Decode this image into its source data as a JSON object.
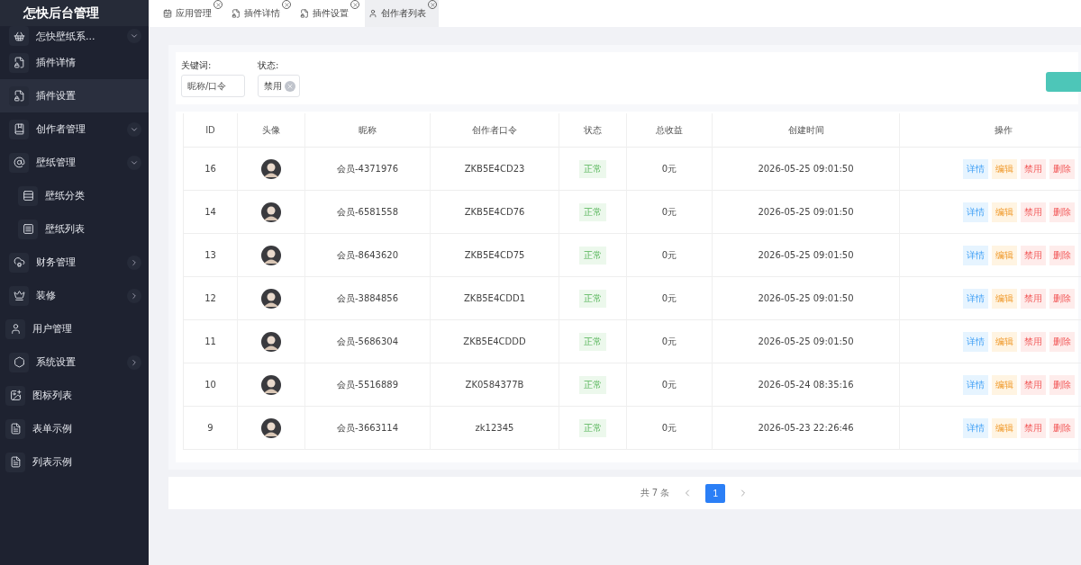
{
  "app": {
    "title": "怎快后台管理"
  },
  "sidebar": {
    "items": [
      {
        "label": "怎快壁纸系...",
        "expanded": true,
        "selected": false,
        "children": [
          {
            "label": "插件详情",
            "selected": false
          },
          {
            "label": "插件设置",
            "selected": true
          }
        ]
      },
      {
        "label": "创作者管理",
        "expanded": true,
        "selected": false
      },
      {
        "label": "壁纸管理",
        "expanded": true,
        "selected": false,
        "children": [
          {
            "label": "壁纸分类",
            "selected": false
          },
          {
            "label": "壁纸列表",
            "selected": false
          }
        ]
      },
      {
        "label": "财务管理",
        "expanded": false,
        "selected": false
      },
      {
        "label": "装修",
        "expanded": false,
        "selected": false
      },
      {
        "label": "用户管理",
        "selected": false
      },
      {
        "label": "系统设置",
        "expanded": false,
        "selected": false
      },
      {
        "label": "图标列表",
        "selected": false
      },
      {
        "label": "表单示例",
        "selected": false
      },
      {
        "label": "列表示例",
        "selected": false
      }
    ]
  },
  "tabs": [
    {
      "label": "应用管理",
      "selected": false
    },
    {
      "label": "插件详情",
      "selected": false
    },
    {
      "label": "插件设置",
      "selected": false
    },
    {
      "label": "创作者列表",
      "selected": true
    }
  ],
  "filters": {
    "keyword": {
      "label": "关键词:",
      "placeholder": "昵称/口令"
    },
    "status": {
      "label": "状态:",
      "value": "禁用"
    }
  },
  "table": {
    "columns": [
      "ID",
      "头像",
      "昵称",
      "创作者口令",
      "状态",
      "总收益",
      "创建时间",
      "操作"
    ],
    "rows": [
      {
        "id": "16",
        "name": "会员-4371976",
        "code": "ZKB5E4CD23",
        "status": "正常",
        "income": "0元",
        "created": "2026-05-25 09:01:50",
        "actions": [
          "详情",
          "编辑",
          "禁用",
          "删除"
        ]
      },
      {
        "id": "14",
        "name": "会员-6581558",
        "code": "ZKB5E4CD76",
        "status": "正常",
        "income": "0元",
        "created": "2026-05-25 09:01:50",
        "actions": [
          "详情",
          "编辑",
          "禁用",
          "删除"
        ]
      },
      {
        "id": "13",
        "name": "会员-8643620",
        "code": "ZKB5E4CD75",
        "status": "正常",
        "income": "0元",
        "created": "2026-05-25 09:01:50",
        "actions": [
          "详情",
          "编辑",
          "禁用",
          "删除"
        ]
      },
      {
        "id": "12",
        "name": "会员-3884856",
        "code": "ZKB5E4CDD1",
        "status": "正常",
        "income": "0元",
        "created": "2026-05-25 09:01:50",
        "actions": [
          "详情",
          "编辑",
          "禁用",
          "删除"
        ]
      },
      {
        "id": "11",
        "name": "会员-5686304",
        "code": "ZKB5E4CDDD",
        "status": "正常",
        "income": "0元",
        "created": "2026-05-25 09:01:50",
        "actions": [
          "详情",
          "编辑",
          "禁用",
          "删除"
        ]
      },
      {
        "id": "10",
        "name": "会员-5516889",
        "code": "ZK0584377B",
        "status": "正常",
        "income": "0元",
        "created": "2026-05-24 08:35:16",
        "actions": [
          "详情",
          "编辑",
          "禁用",
          "删除"
        ]
      },
      {
        "id": "9",
        "name": "会员-3663114",
        "code": "zk12345",
        "status": "正常",
        "income": "0元",
        "created": "2026-05-23 22:26:46",
        "actions": [
          "详情",
          "编辑",
          "禁用",
          "删除"
        ]
      }
    ]
  },
  "pagination": {
    "total": "共 7 条",
    "pages": [
      {
        "label": "1",
        "selected": true
      }
    ]
  }
}
